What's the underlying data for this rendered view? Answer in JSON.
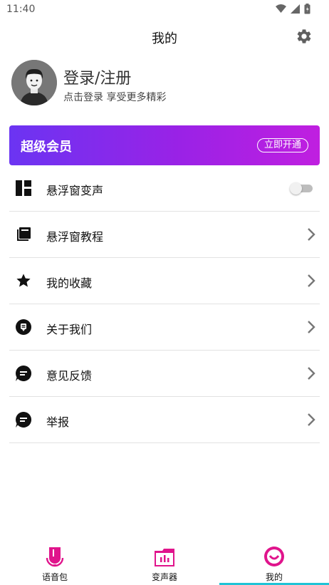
{
  "status_bar": {
    "time": "11:40",
    "icons": [
      "wifi-icon",
      "signal-icon",
      "battery-icon"
    ]
  },
  "header": {
    "title": "我的",
    "settings_icon": "gear-icon"
  },
  "profile": {
    "title": "登录/注册",
    "subtitle": "点击登录 享受更多精彩"
  },
  "vip": {
    "title": "超级会员",
    "button": "立即开通",
    "colors": [
      "#6b34f2",
      "#c01fe0"
    ]
  },
  "menu": {
    "items": [
      {
        "label": "悬浮窗变声",
        "icon": "dashboard-icon",
        "control": "toggle",
        "toggle_on": false
      },
      {
        "label": "悬浮窗教程",
        "icon": "book-icon",
        "control": "chevron"
      },
      {
        "label": "我的收藏",
        "icon": "star-icon",
        "control": "chevron"
      },
      {
        "label": "关于我们",
        "icon": "info-bubble-icon",
        "control": "chevron"
      },
      {
        "label": "意见反馈",
        "icon": "chat-icon",
        "control": "chevron"
      },
      {
        "label": "举报",
        "icon": "chat-icon",
        "control": "chevron"
      }
    ]
  },
  "tabbar": {
    "tabs": [
      {
        "label": "语音包",
        "icon": "voice-pack-icon",
        "active": false
      },
      {
        "label": "变声器",
        "icon": "voice-changer-icon",
        "active": false
      },
      {
        "label": "我的",
        "icon": "profile-smile-icon",
        "active": true
      }
    ],
    "accent": "#e0148c",
    "indicator_color": "#1fc3d6"
  }
}
